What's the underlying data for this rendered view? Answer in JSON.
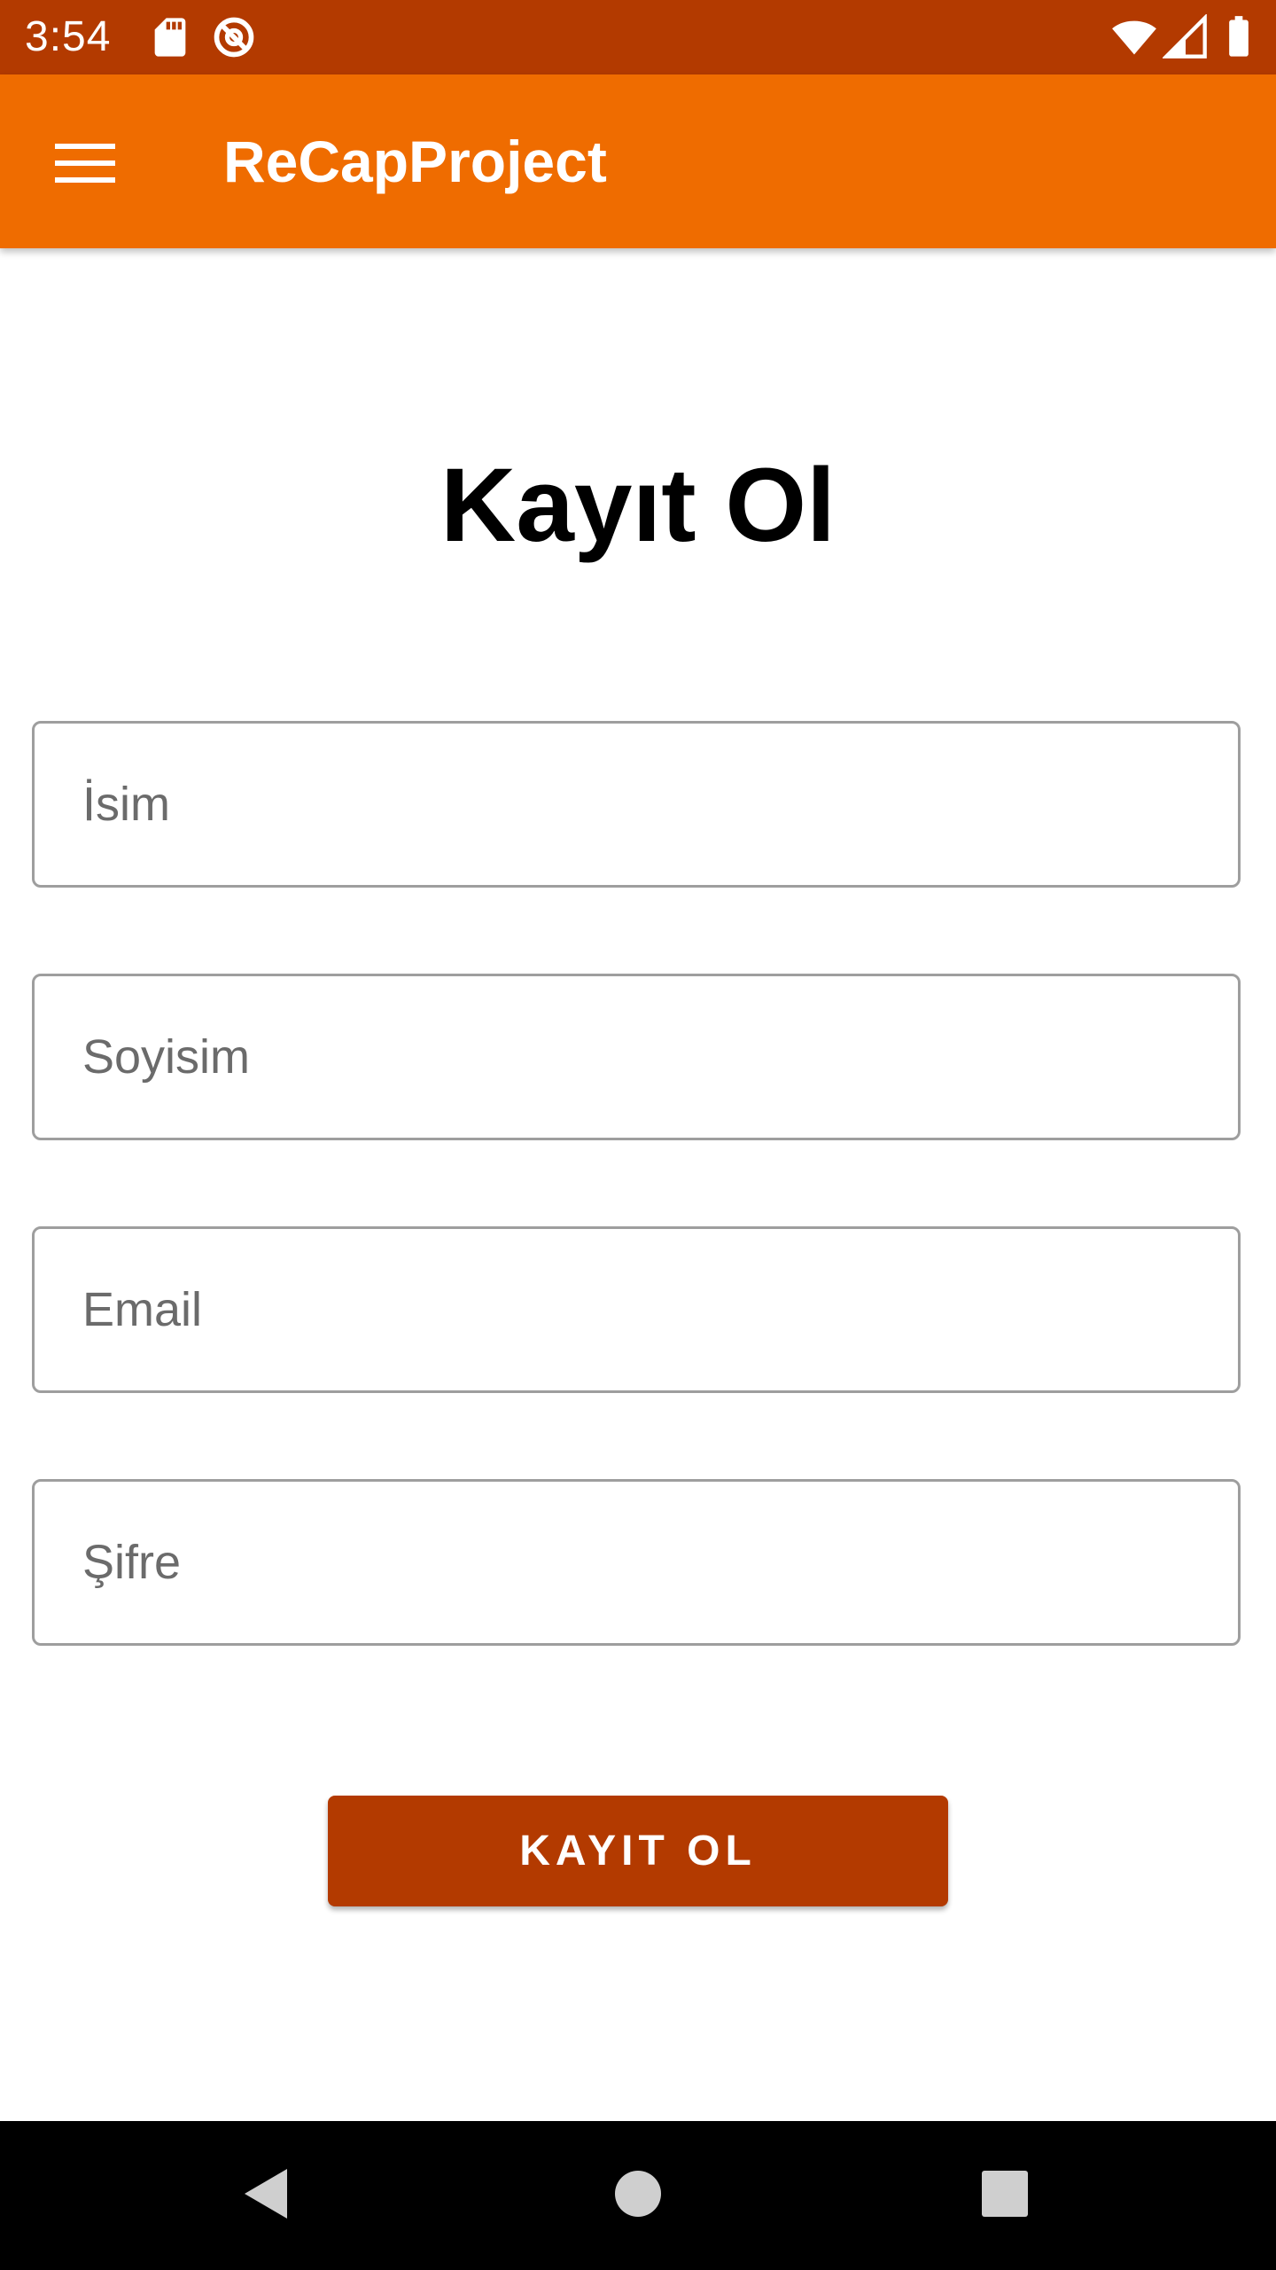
{
  "status_bar": {
    "time": "3:54",
    "icons": [
      "sd-card-icon",
      "sync-disabled-icon",
      "wifi-icon",
      "cellular-signal-icon",
      "battery-icon"
    ],
    "background": "#B33A00"
  },
  "app_bar": {
    "title": "ReCapProject",
    "menu_icon": "hamburger-menu-icon",
    "background": "#EF6C00"
  },
  "form": {
    "title": "Kayıt Ol",
    "fields": [
      {
        "name": "name",
        "placeholder": "İsim",
        "value": ""
      },
      {
        "name": "surname",
        "placeholder": "Soyisim",
        "value": ""
      },
      {
        "name": "email",
        "placeholder": "Email",
        "value": ""
      },
      {
        "name": "password",
        "placeholder": "Şifre",
        "value": ""
      }
    ],
    "submit_label": "KAYIT OL",
    "submit_color": "#B33A00"
  },
  "nav_bar": {
    "buttons": [
      "back-icon",
      "home-icon",
      "recents-icon"
    ]
  }
}
